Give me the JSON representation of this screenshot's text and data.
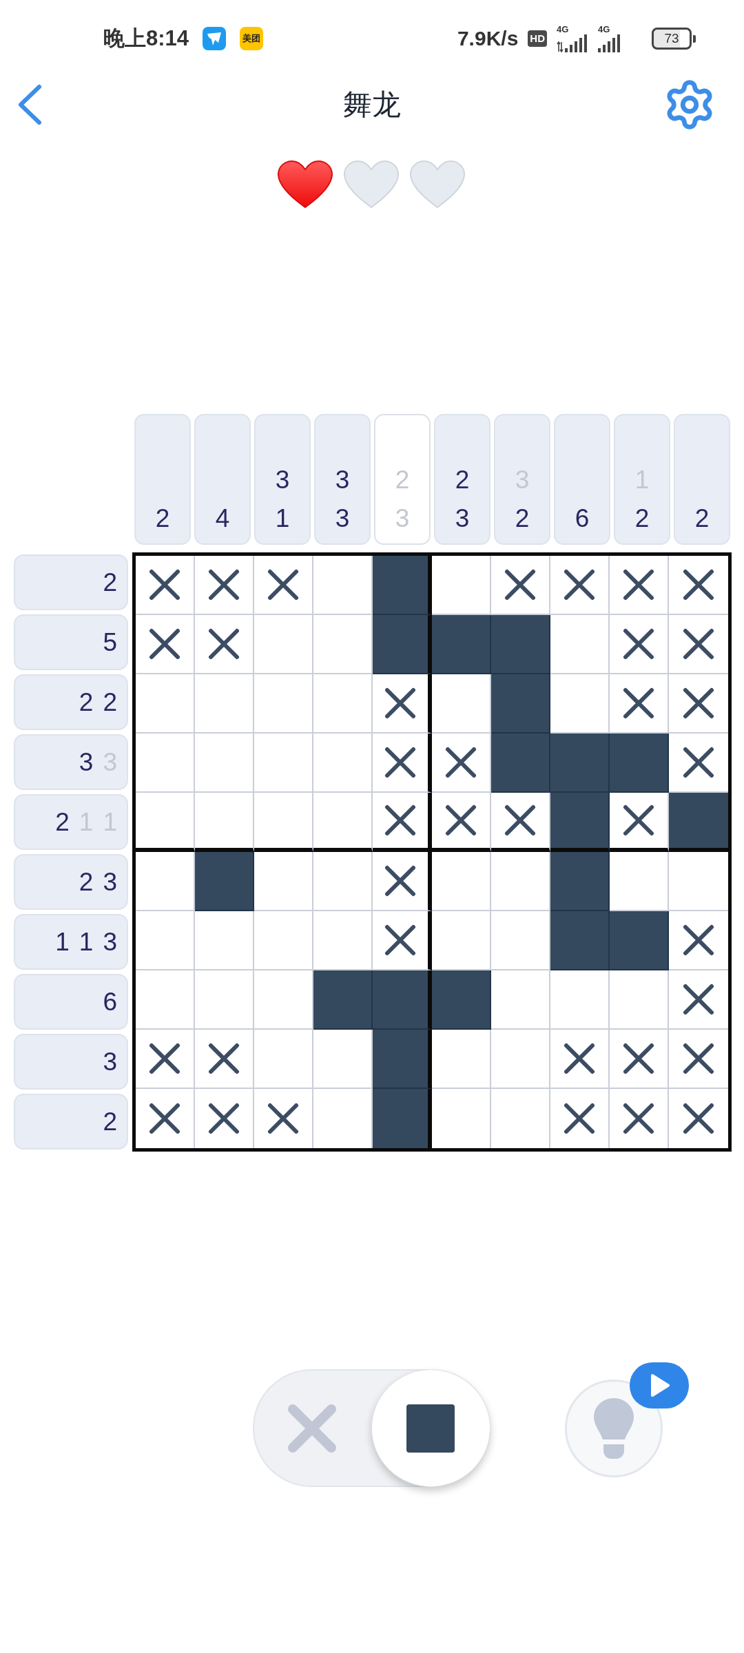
{
  "status_bar": {
    "time": "晚上8:14",
    "notification_icons": [
      {
        "kind": "wing"
      },
      {
        "kind": "tile",
        "label": "美团"
      }
    ],
    "speed": "7.9K/s",
    "hd": "HD",
    "networks": [
      {
        "label": "4G",
        "arrows": true
      },
      {
        "label": "4G",
        "arrows": false
      }
    ],
    "battery": "73"
  },
  "header": {
    "title": "舞龙"
  },
  "lives": [
    {
      "full": true
    },
    {
      "full": false
    },
    {
      "full": false
    }
  ],
  "column_clues": [
    {
      "complete": false,
      "numbers": [
        {
          "value": "2",
          "done": false
        }
      ]
    },
    {
      "complete": false,
      "numbers": [
        {
          "value": "4",
          "done": false
        }
      ]
    },
    {
      "complete": false,
      "numbers": [
        {
          "value": "3",
          "done": false
        },
        {
          "value": "1",
          "done": false
        }
      ]
    },
    {
      "complete": false,
      "numbers": [
        {
          "value": "3",
          "done": false
        },
        {
          "value": "3",
          "done": false
        }
      ]
    },
    {
      "complete": true,
      "numbers": [
        {
          "value": "2",
          "done": true
        },
        {
          "value": "3",
          "done": true
        }
      ]
    },
    {
      "complete": false,
      "numbers": [
        {
          "value": "2",
          "done": false
        },
        {
          "value": "3",
          "done": false
        }
      ]
    },
    {
      "complete": false,
      "numbers": [
        {
          "value": "3",
          "done": true
        },
        {
          "value": "2",
          "done": false
        }
      ]
    },
    {
      "complete": false,
      "numbers": [
        {
          "value": "6",
          "done": false
        }
      ]
    },
    {
      "complete": false,
      "numbers": [
        {
          "value": "1",
          "done": true
        },
        {
          "value": "2",
          "done": false
        }
      ]
    },
    {
      "complete": false,
      "numbers": [
        {
          "value": "2",
          "done": false
        }
      ]
    }
  ],
  "row_clues": [
    {
      "numbers": [
        {
          "value": "2",
          "done": false
        }
      ]
    },
    {
      "numbers": [
        {
          "value": "5",
          "done": false
        }
      ]
    },
    {
      "numbers": [
        {
          "value": "2",
          "done": false
        },
        {
          "value": "2",
          "done": false
        }
      ]
    },
    {
      "numbers": [
        {
          "value": "3",
          "done": false
        },
        {
          "value": "3",
          "done": true
        }
      ]
    },
    {
      "numbers": [
        {
          "value": "2",
          "done": false
        },
        {
          "value": "1",
          "done": true
        },
        {
          "value": "1",
          "done": true
        }
      ]
    },
    {
      "numbers": [
        {
          "value": "2",
          "done": false
        },
        {
          "value": "3",
          "done": false
        }
      ]
    },
    {
      "numbers": [
        {
          "value": "1",
          "done": false
        },
        {
          "value": "1",
          "done": false
        },
        {
          "value": "3",
          "done": false
        }
      ]
    },
    {
      "numbers": [
        {
          "value": "6",
          "done": false
        }
      ]
    },
    {
      "numbers": [
        {
          "value": "3",
          "done": false
        }
      ]
    },
    {
      "numbers": [
        {
          "value": "2",
          "done": false
        }
      ]
    }
  ],
  "grid": {
    "rows": [
      {
        "cells": [
          {
            "filled": false,
            "crossed": true
          },
          {
            "filled": false,
            "crossed": true
          },
          {
            "filled": false,
            "crossed": true
          },
          {
            "filled": false,
            "crossed": false
          },
          {
            "filled": true,
            "crossed": false
          },
          {
            "filled": false,
            "crossed": false
          },
          {
            "filled": false,
            "crossed": true
          },
          {
            "filled": false,
            "crossed": true
          },
          {
            "filled": false,
            "crossed": true
          },
          {
            "filled": false,
            "crossed": true
          }
        ]
      },
      {
        "cells": [
          {
            "filled": false,
            "crossed": true
          },
          {
            "filled": false,
            "crossed": true
          },
          {
            "filled": false,
            "crossed": false
          },
          {
            "filled": false,
            "crossed": false
          },
          {
            "filled": true,
            "crossed": false
          },
          {
            "filled": true,
            "crossed": false
          },
          {
            "filled": true,
            "crossed": false
          },
          {
            "filled": false,
            "crossed": false
          },
          {
            "filled": false,
            "crossed": true
          },
          {
            "filled": false,
            "crossed": true
          }
        ]
      },
      {
        "cells": [
          {
            "filled": false,
            "crossed": false
          },
          {
            "filled": false,
            "crossed": false
          },
          {
            "filled": false,
            "crossed": false
          },
          {
            "filled": false,
            "crossed": false
          },
          {
            "filled": false,
            "crossed": true
          },
          {
            "filled": false,
            "crossed": false
          },
          {
            "filled": true,
            "crossed": false
          },
          {
            "filled": false,
            "crossed": false
          },
          {
            "filled": false,
            "crossed": true
          },
          {
            "filled": false,
            "crossed": true
          }
        ]
      },
      {
        "cells": [
          {
            "filled": false,
            "crossed": false
          },
          {
            "filled": false,
            "crossed": false
          },
          {
            "filled": false,
            "crossed": false
          },
          {
            "filled": false,
            "crossed": false
          },
          {
            "filled": false,
            "crossed": true
          },
          {
            "filled": false,
            "crossed": true
          },
          {
            "filled": true,
            "crossed": false
          },
          {
            "filled": true,
            "crossed": false
          },
          {
            "filled": true,
            "crossed": false
          },
          {
            "filled": false,
            "crossed": true
          }
        ]
      },
      {
        "cells": [
          {
            "filled": false,
            "crossed": false
          },
          {
            "filled": false,
            "crossed": false
          },
          {
            "filled": false,
            "crossed": false
          },
          {
            "filled": false,
            "crossed": false
          },
          {
            "filled": false,
            "crossed": true
          },
          {
            "filled": false,
            "crossed": true
          },
          {
            "filled": false,
            "crossed": true
          },
          {
            "filled": true,
            "crossed": false
          },
          {
            "filled": false,
            "crossed": true
          },
          {
            "filled": true,
            "crossed": false
          }
        ]
      },
      {
        "cells": [
          {
            "filled": false,
            "crossed": false
          },
          {
            "filled": true,
            "crossed": false
          },
          {
            "filled": false,
            "crossed": false
          },
          {
            "filled": false,
            "crossed": false
          },
          {
            "filled": false,
            "crossed": true
          },
          {
            "filled": false,
            "crossed": false
          },
          {
            "filled": false,
            "crossed": false
          },
          {
            "filled": true,
            "crossed": false
          },
          {
            "filled": false,
            "crossed": false
          },
          {
            "filled": false,
            "crossed": false
          }
        ]
      },
      {
        "cells": [
          {
            "filled": false,
            "crossed": false
          },
          {
            "filled": false,
            "crossed": false
          },
          {
            "filled": false,
            "crossed": false
          },
          {
            "filled": false,
            "crossed": false
          },
          {
            "filled": false,
            "crossed": true
          },
          {
            "filled": false,
            "crossed": false
          },
          {
            "filled": false,
            "crossed": false
          },
          {
            "filled": true,
            "crossed": false
          },
          {
            "filled": true,
            "crossed": false
          },
          {
            "filled": false,
            "crossed": true
          }
        ]
      },
      {
        "cells": [
          {
            "filled": false,
            "crossed": false
          },
          {
            "filled": false,
            "crossed": false
          },
          {
            "filled": false,
            "crossed": false
          },
          {
            "filled": true,
            "crossed": false
          },
          {
            "filled": true,
            "crossed": false
          },
          {
            "filled": true,
            "crossed": false
          },
          {
            "filled": false,
            "crossed": false
          },
          {
            "filled": false,
            "crossed": false
          },
          {
            "filled": false,
            "crossed": false
          },
          {
            "filled": false,
            "crossed": true
          }
        ]
      },
      {
        "cells": [
          {
            "filled": false,
            "crossed": true
          },
          {
            "filled": false,
            "crossed": true
          },
          {
            "filled": false,
            "crossed": false
          },
          {
            "filled": false,
            "crossed": false
          },
          {
            "filled": true,
            "crossed": false
          },
          {
            "filled": false,
            "crossed": false
          },
          {
            "filled": false,
            "crossed": false
          },
          {
            "filled": false,
            "crossed": true
          },
          {
            "filled": false,
            "crossed": true
          },
          {
            "filled": false,
            "crossed": true
          }
        ]
      },
      {
        "cells": [
          {
            "filled": false,
            "crossed": true
          },
          {
            "filled": false,
            "crossed": true
          },
          {
            "filled": false,
            "crossed": true
          },
          {
            "filled": false,
            "crossed": false
          },
          {
            "filled": true,
            "crossed": false
          },
          {
            "filled": false,
            "crossed": false
          },
          {
            "filled": false,
            "crossed": false
          },
          {
            "filled": false,
            "crossed": true
          },
          {
            "filled": false,
            "crossed": true
          },
          {
            "filled": false,
            "crossed": true
          }
        ]
      }
    ]
  },
  "mode_toggle": [
    {
      "kind": "cross",
      "selected": false
    },
    {
      "kind": "fill",
      "selected": true
    }
  ]
}
